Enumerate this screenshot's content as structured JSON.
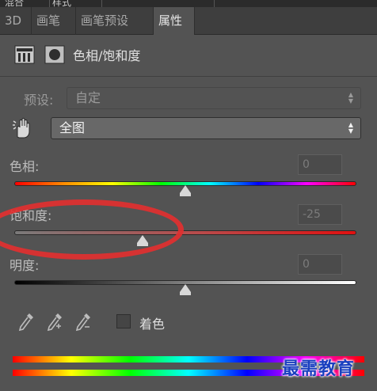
{
  "tabs": [
    "3D",
    "画笔",
    "画笔预设",
    "属性"
  ],
  "top_strip_labels": [
    "混合",
    "样式"
  ],
  "header": {
    "title": "色相/饱和度"
  },
  "preset": {
    "label": "预设:",
    "value": "自定"
  },
  "channel": {
    "value": "全图"
  },
  "hue": {
    "label": "色相:",
    "value": "0",
    "level": 0
  },
  "saturation": {
    "label": "饱和度:",
    "value": "-25",
    "level": -25
  },
  "lightness": {
    "label": "明度:",
    "value": "0",
    "level": 0
  },
  "colorize": {
    "label": "着色",
    "checked": false
  },
  "watermark": "最需教育",
  "colors": {
    "panel_bg": "#535353",
    "annotation": "#e23030",
    "watermark": "#1a3fbf"
  }
}
